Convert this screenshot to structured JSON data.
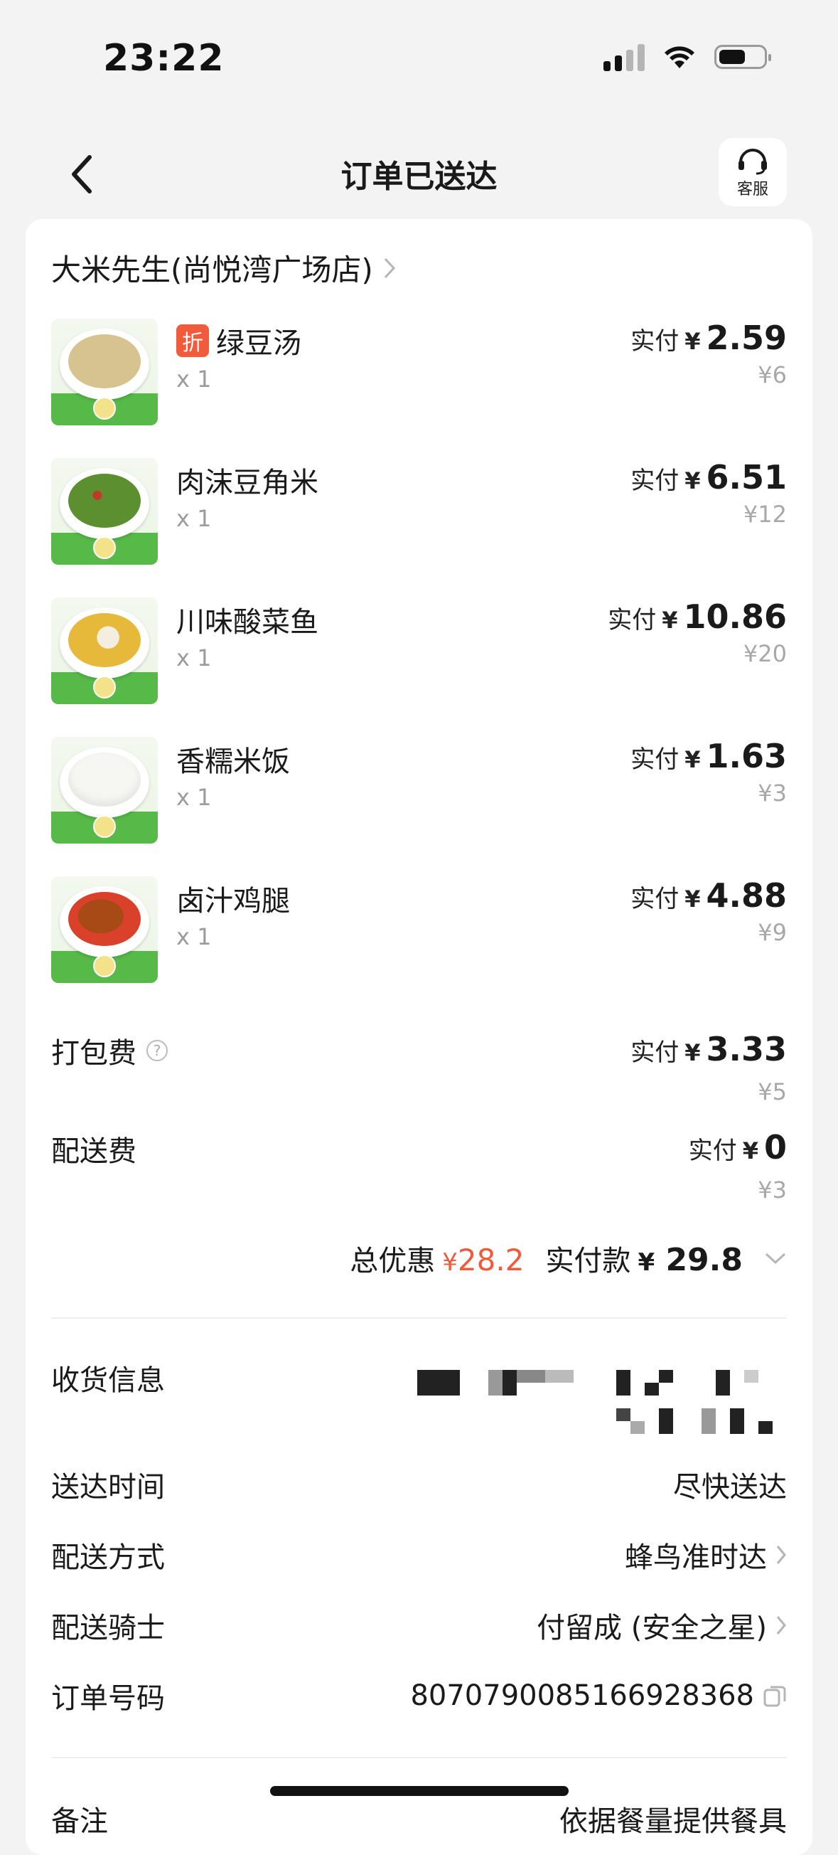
{
  "status_bar": {
    "time": "23:22"
  },
  "header": {
    "title": "订单已送达",
    "service_label": "客服"
  },
  "store": {
    "name": "大米先生(尚悦湾广场店)"
  },
  "items": [
    {
      "name": "绿豆汤",
      "badge": "折",
      "qty": "x 1",
      "paid_label": "实付",
      "currency": "¥",
      "paid": "2.59",
      "original": "¥6",
      "food_color": "#d7c38f",
      "tag_color": "#f0dc78"
    },
    {
      "name": "肉沫豆角米",
      "badge": "",
      "qty": "x 1",
      "paid_label": "实付",
      "currency": "¥",
      "paid": "6.51",
      "original": "¥12",
      "food_color": "#5b8f2f",
      "tag_color": "#f0dc78"
    },
    {
      "name": "川味酸菜鱼",
      "badge": "",
      "qty": "x 1",
      "paid_label": "实付",
      "currency": "¥",
      "paid": "10.86",
      "original": "¥20",
      "food_color": "#e6b93a",
      "tag_color": "#f0dc78"
    },
    {
      "name": "香糯米饭",
      "badge": "",
      "qty": "x 1",
      "paid_label": "实付",
      "currency": "¥",
      "paid": "1.63",
      "original": "¥3",
      "food_color": "#f6f6f2",
      "tag_color": "#f0dc78"
    },
    {
      "name": "卤汁鸡腿",
      "badge": "",
      "qty": "x 1",
      "paid_label": "实付",
      "currency": "¥",
      "paid": "4.88",
      "original": "¥9",
      "food_color": "#b5551d",
      "tag_color": "#f0dc78"
    }
  ],
  "fees": {
    "packing": {
      "label": "打包费",
      "help": "?",
      "paid_label": "实付",
      "currency": "¥",
      "paid": "3.33",
      "original": "¥5"
    },
    "delivery": {
      "label": "配送费",
      "paid_label": "实付",
      "currency": "¥",
      "paid": "0",
      "original": "¥3"
    }
  },
  "totals": {
    "discount_label": "总优惠",
    "discount_currency": "¥",
    "discount": "28.2",
    "paid_label": "实付款",
    "paid_currency": "¥",
    "paid": "29.8"
  },
  "info": {
    "receive": {
      "label": "收货信息"
    },
    "time": {
      "label": "送达时间",
      "value": "尽快送达"
    },
    "method": {
      "label": "配送方式",
      "value": "蜂鸟准时达"
    },
    "rider": {
      "label": "配送骑士",
      "value": "付留成 (安全之星)"
    },
    "order_no": {
      "label": "订单号码",
      "value": "8070790085166928368"
    },
    "note": {
      "label": "备注",
      "value": "依据餐量提供餐具"
    }
  },
  "colors": {
    "accent_red": "#f05a3a",
    "badge_red": "#f25a3c",
    "background": "#f3f3f3",
    "card": "#ffffff"
  }
}
